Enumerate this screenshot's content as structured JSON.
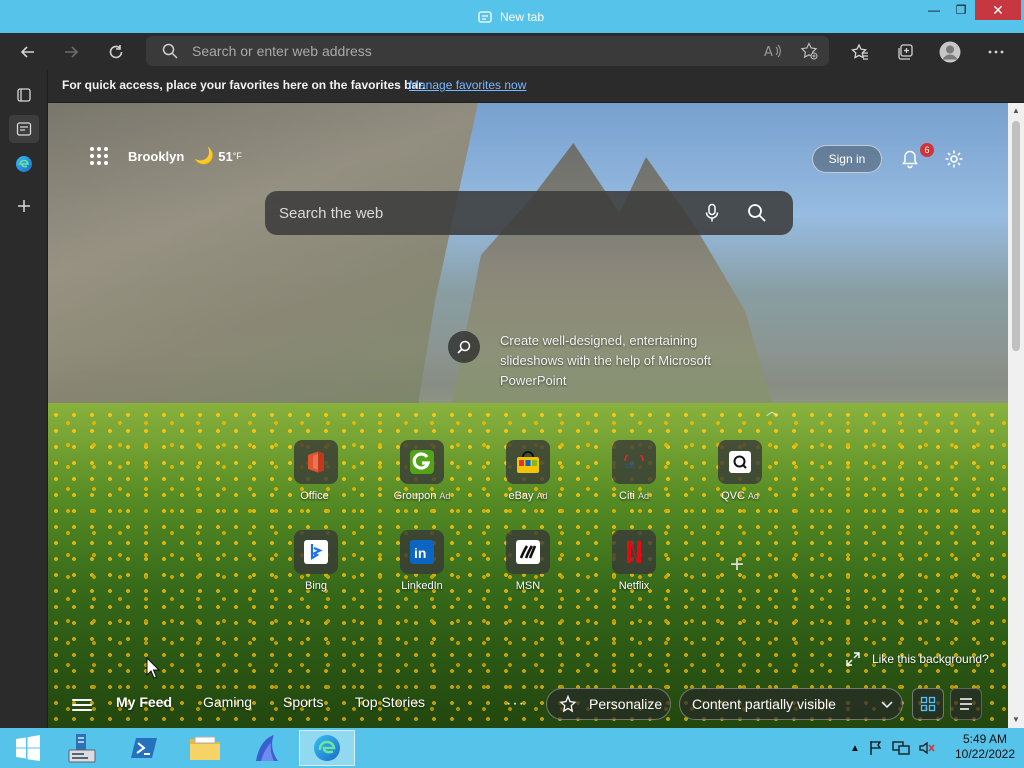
{
  "window": {
    "title": "New tab",
    "controls": {
      "minimize": "—",
      "maximize": "❐",
      "close": "✕"
    }
  },
  "toolbar": {
    "address_placeholder": "Search or enter web address"
  },
  "favorites_bar": {
    "message": "For quick access, place your favorites here on the favorites bar.",
    "link": "Manage favorites now"
  },
  "newtab": {
    "location": "Brooklyn",
    "temperature": "51",
    "temp_unit": "°F",
    "signin": "Sign in",
    "notifications_count": "6",
    "search_placeholder": "Search the web",
    "tip_text": "Create well-designed, entertaining slideshows with the help of Microsoft PowerPoint",
    "like_background": "Like this background?",
    "quick_links": [
      {
        "label": "Office",
        "ad": "",
        "icon": "office-icon"
      },
      {
        "label": "Groupon",
        "ad": "Ad",
        "icon": "groupon-icon"
      },
      {
        "label": "eBay",
        "ad": "Ad",
        "icon": "ebay-icon"
      },
      {
        "label": "Citi",
        "ad": "Ad",
        "icon": "citi-icon"
      },
      {
        "label": "QVC",
        "ad": "Ad",
        "icon": "qvc-icon"
      },
      {
        "label": "Bing",
        "ad": "",
        "icon": "bing-icon"
      },
      {
        "label": "LinkedIn",
        "ad": "",
        "icon": "linkedin-icon"
      },
      {
        "label": "MSN",
        "ad": "",
        "icon": "msn-icon"
      },
      {
        "label": "Netflix",
        "ad": "",
        "icon": "netflix-icon"
      }
    ],
    "feed": {
      "tabs": [
        "My Feed",
        "Gaming",
        "Sports",
        "Top Stories"
      ],
      "active_tab": "My Feed",
      "more": "···",
      "personalize": "Personalize",
      "content_setting": "Content partially visible"
    }
  },
  "taskbar": {
    "time": "5:49 AM",
    "date": "10/22/2022"
  },
  "colors": {
    "titlebar": "#56c3ea",
    "chrome_dark": "#2b2b2b",
    "link_blue": "#79b8ff",
    "badge_red": "#d13438",
    "close_red": "#c7373f"
  }
}
